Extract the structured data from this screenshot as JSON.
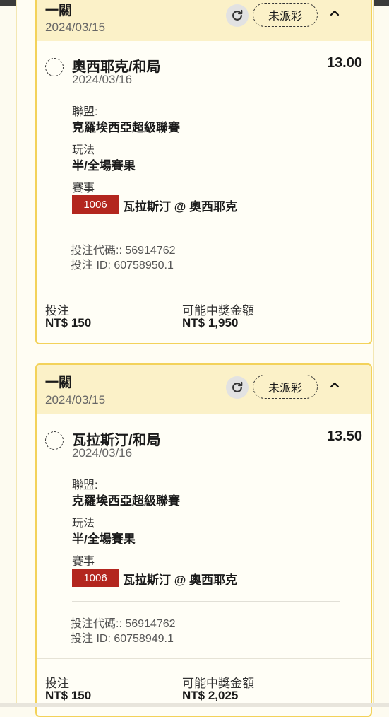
{
  "tickets": [
    {
      "title": "一關",
      "date": "2024/03/15",
      "status": "未派彩",
      "selection": {
        "name": "奧西耶克/和局",
        "odds": "13.00",
        "date": "2024/03/16",
        "league_label": "聯盟:",
        "league": "克羅埃西亞超級聯賽",
        "market_label": "玩法",
        "market": "半/全場賽果",
        "event_label": "賽事",
        "event_id": "1006",
        "event": "瓦拉斯汀 @ 奧西耶克",
        "bet_code": "投注代碼:: 56914762",
        "bet_id": "投注 ID: 60758950.1"
      },
      "stake_label": "投注",
      "stake": "NT$ 150",
      "payout_label": "可能中獎金額",
      "payout": "NT$ 1,950"
    },
    {
      "title": "一關",
      "date": "2024/03/15",
      "status": "未派彩",
      "selection": {
        "name": "瓦拉斯汀/和局",
        "odds": "13.50",
        "date": "2024/03/16",
        "league_label": "聯盟:",
        "league": "克羅埃西亞超級聯賽",
        "market_label": "玩法",
        "market": "半/全場賽果",
        "event_label": "賽事",
        "event_id": "1006",
        "event": "瓦拉斯汀 @ 奧西耶克",
        "bet_code": "投注代碼:: 56914762",
        "bet_id": "投注 ID: 60758949.1"
      },
      "stake_label": "投注",
      "stake": "NT$ 150",
      "payout_label": "可能中獎金額",
      "payout": "NT$ 2,025"
    }
  ],
  "icons": {
    "refresh": "refresh-icon",
    "chevron": "chevron-up-icon",
    "radio": "radio-unselected-icon"
  },
  "colors": {
    "header_bg": "#fbf1c8",
    "border": "#f3d25a",
    "badge": "#b3261e"
  }
}
